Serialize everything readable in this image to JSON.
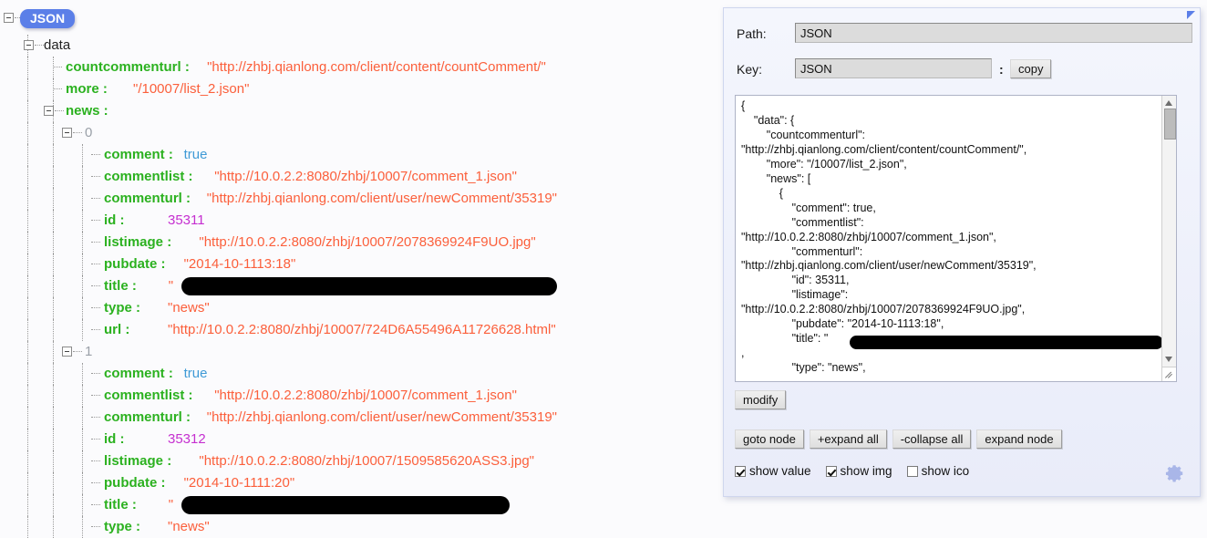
{
  "tree": {
    "root_badge": "JSON",
    "root_child": "data",
    "data_fields": [
      {
        "key": "countcommenturl :",
        "value": "\"http://zhbj.qianlong.com/client/content/countComment/\"",
        "type": "str"
      },
      {
        "key": "more :",
        "value": "\"/10007/list_2.json\"",
        "type": "str"
      },
      {
        "key": "news :",
        "value": "",
        "type": "node"
      }
    ],
    "news": [
      {
        "index": "0",
        "fields": [
          {
            "key": "comment :",
            "value": "true",
            "type": "bool"
          },
          {
            "key": "commentlist :",
            "value": "\"http://10.0.2.2:8080/zhbj/10007/comment_1.json\"",
            "type": "str"
          },
          {
            "key": "commenturl :",
            "value": "\"http://zhbj.qianlong.com/client/user/newComment/35319\"",
            "type": "str"
          },
          {
            "key": "id :",
            "value": "35311",
            "type": "num"
          },
          {
            "key": "listimage :",
            "value": "\"http://10.0.2.2:8080/zhbj/10007/2078369924F9UO.jpg\"",
            "type": "str"
          },
          {
            "key": "pubdate :",
            "value": "\"2014-10-1113:18\"",
            "type": "str"
          },
          {
            "key": "title :",
            "value": "\"",
            "type": "redacted"
          },
          {
            "key": "type :",
            "value": "\"news\"",
            "type": "str"
          },
          {
            "key": "url :",
            "value": "\"http://10.0.2.2:8080/zhbj/10007/724D6A55496A11726628.html\"",
            "type": "str"
          }
        ]
      },
      {
        "index": "1",
        "fields": [
          {
            "key": "comment :",
            "value": "true",
            "type": "bool"
          },
          {
            "key": "commentlist :",
            "value": "\"http://10.0.2.2:8080/zhbj/10007/comment_1.json\"",
            "type": "str"
          },
          {
            "key": "commenturl :",
            "value": "\"http://zhbj.qianlong.com/client/user/newComment/35319\"",
            "type": "str"
          },
          {
            "key": "id :",
            "value": "35312",
            "type": "num"
          },
          {
            "key": "listimage :",
            "value": "\"http://10.0.2.2:8080/zhbj/10007/1509585620ASS3.jpg\"",
            "type": "str"
          },
          {
            "key": "pubdate :",
            "value": "\"2014-10-1111:20\"",
            "type": "str"
          },
          {
            "key": "title :",
            "value": "\"",
            "type": "redacted"
          },
          {
            "key": "type :",
            "value": "\"news\"",
            "type": "str"
          }
        ]
      }
    ]
  },
  "inspector": {
    "path_label": "Path:",
    "path_value": "JSON",
    "key_label": "Key:",
    "key_value": "JSON",
    "key_separator": ":",
    "copy_label": "copy",
    "json_text": "{\n    \"data\": {\n        \"countcommenturl\":\n\"http://zhbj.qianlong.com/client/content/countComment/\",\n        \"more\": \"/10007/list_2.json\",\n        \"news\": [\n            {\n                \"comment\": true,\n                \"commentlist\":\n\"http://10.0.2.2:8080/zhbj/10007/comment_1.json\",\n                \"commenturl\":\n\"http://zhbj.qianlong.com/client/user/newComment/35319\",\n                \"id\": 35311,\n                \"listimage\":\n\"http://10.0.2.2:8080/zhbj/10007/2078369924F9UO.jpg\",\n                \"pubdate\": \"2014-10-1113:18\",\n                \"title\": \"\n,\n                \"type\": \"news\",",
    "modify_label": "modify",
    "buttons": [
      "goto node",
      "+expand all",
      "-collapse all",
      "expand node"
    ],
    "checkboxes": [
      {
        "label": "show value",
        "checked": true
      },
      {
        "label": "show img",
        "checked": true
      },
      {
        "label": "show ico",
        "checked": false
      }
    ],
    "gear_icon": "gear-icon",
    "collapse_icon": "collapse-triangle-icon"
  },
  "colors": {
    "key": "#2bb11f",
    "string": "#fb5f3b",
    "number": "#c52fd0",
    "boolean": "#3f9ad6",
    "badge": "#5b7fe8",
    "panel": "#eef1fb"
  }
}
